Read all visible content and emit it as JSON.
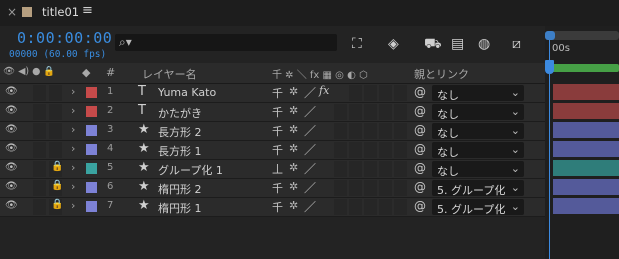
{
  "tab": {
    "close": "×",
    "title": "title01",
    "menu": "≡",
    "swatch_color": "#b69f80"
  },
  "toolbar": {
    "timecode": "0:00:00:00",
    "frames": "00000 (60.00 fps)",
    "search_placeholder": "",
    "search_icon": "⌕▾",
    "tools": [
      {
        "name": "composition-flowchart-icon",
        "glyph": "⛶"
      },
      {
        "name": "draft-3d-icon",
        "glyph": "◈"
      },
      {
        "name": "shy-layers-icon",
        "glyph": "⛟"
      },
      {
        "name": "frame-blending-icon",
        "glyph": "▤"
      },
      {
        "name": "motion-blur-icon",
        "glyph": "◍"
      },
      {
        "name": "graph-editor-icon",
        "glyph": "⧄"
      }
    ]
  },
  "timeline": {
    "time_label": "00s",
    "accent": "#3c8ae0",
    "work_area_color": "#46a046"
  },
  "header": {
    "av_icons": "👁 ◀) ● 🔒",
    "label_icon": "◆",
    "number": "#",
    "layer_name": "レイヤー名",
    "switches": "千 ✲ ＼ fx ▦ ◎ ◐ ⬡",
    "parent": "親とリンク"
  },
  "layers": [
    {
      "num": "1",
      "type": "T",
      "name": "Yuma Kato",
      "color": "#c64a4a",
      "locked": false,
      "fx": true,
      "shy": "千",
      "parent": "なし",
      "track": "#8a3c3c"
    },
    {
      "num": "2",
      "type": "T",
      "name": "かたがき",
      "color": "#c64a4a",
      "locked": false,
      "fx": false,
      "shy": "千",
      "parent": "なし",
      "track": "#8a3c3c"
    },
    {
      "num": "3",
      "type": "★",
      "name": "長方形 2",
      "color": "#7d82d6",
      "locked": false,
      "fx": false,
      "shy": "千",
      "parent": "なし",
      "track": "#545a9a"
    },
    {
      "num": "4",
      "type": "★",
      "name": "長方形 1",
      "color": "#7d82d6",
      "locked": false,
      "fx": false,
      "shy": "千",
      "parent": "なし",
      "track": "#545a9a"
    },
    {
      "num": "5",
      "type": "★",
      "name": "グループ化 1",
      "color": "#3aa3a0",
      "locked": true,
      "fx": false,
      "shy": "丄",
      "parent": "なし",
      "track": "#2f7d7a"
    },
    {
      "num": "6",
      "type": "★",
      "name": "楕円形 2",
      "color": "#7d82d6",
      "locked": true,
      "fx": false,
      "shy": "千",
      "parent": "5. グループ化",
      "track": "#545a9a"
    },
    {
      "num": "7",
      "type": "★",
      "name": "楕円形 1",
      "color": "#7d82d6",
      "locked": true,
      "fx": false,
      "shy": "千",
      "parent": "5. グループ化",
      "track": "#545a9a"
    }
  ]
}
